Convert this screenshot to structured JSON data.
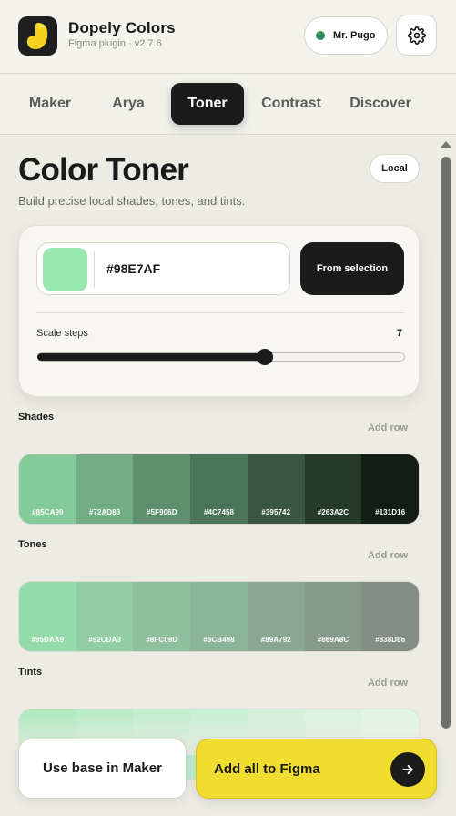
{
  "header": {
    "app_name": "Dopely Colors",
    "app_sub": "Figma plugin · v2.7.6",
    "user_name": "Mr. Pugo",
    "user_status_color": "#2e8b57"
  },
  "tabs": [
    {
      "label": "Maker",
      "active": false
    },
    {
      "label": "Arya",
      "active": false
    },
    {
      "label": "Toner",
      "active": true
    },
    {
      "label": "Contrast",
      "active": false
    },
    {
      "label": "Discover",
      "active": false
    }
  ],
  "page": {
    "title": "Color Toner",
    "badge": "Local",
    "subtitle": "Build precise local shades, tones, and tints."
  },
  "picker": {
    "base_color": "#98E7AF",
    "hex_value": "#98E7AF",
    "from_selection_label": "From selection",
    "scale_steps_label": "Scale steps",
    "scale_steps_value": "7",
    "slider_fraction": 0.62
  },
  "sections": {
    "shades": {
      "label": "Shades",
      "add_row": "Add row",
      "colors": [
        "#85CA99",
        "#72AD83",
        "#5F906D",
        "#4C7458",
        "#395742",
        "#263A2C",
        "#131D16"
      ]
    },
    "tones": {
      "label": "Tones",
      "add_row": "Add row",
      "colors": [
        "#95DAA9",
        "#92CDA3",
        "#8FC09D",
        "#8CB498",
        "#89A792",
        "#869A8C",
        "#838D86"
      ]
    },
    "tints": {
      "label": "Tints",
      "add_row": "Add row",
      "colors": [
        "#A2E9B7",
        "#ADECC0",
        "#B7EEC8",
        "#C1F1D0",
        "#CCF3D8",
        "#D6F6E0",
        "#E0F8E8"
      ]
    }
  },
  "footer": {
    "use_base_label": "Use base in Maker",
    "add_all_label": "Add all to Figma",
    "accent_color": "#F1DD2F"
  },
  "icons": {
    "logo": "dopely-logo-icon",
    "settings": "gear-icon",
    "submit": "arrow-right-icon",
    "scroll_up": "scroll-up-icon"
  }
}
